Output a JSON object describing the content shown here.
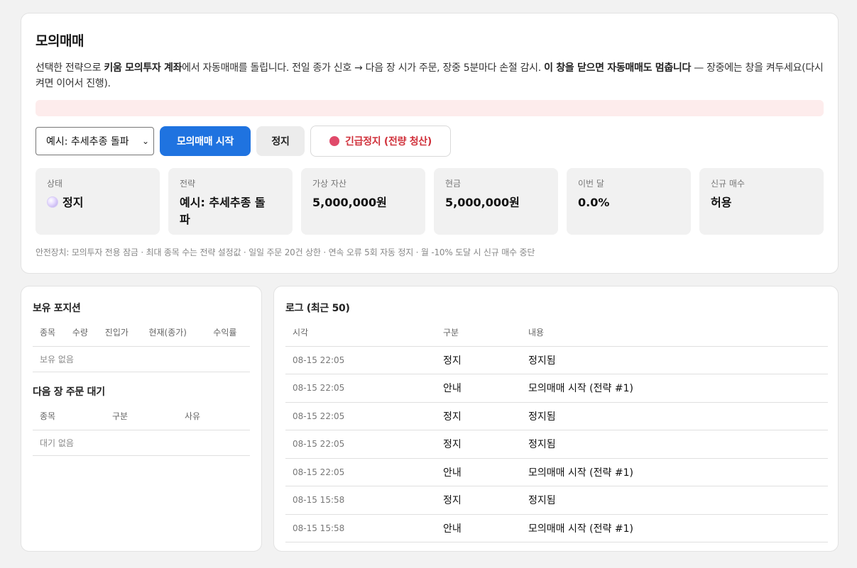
{
  "header": {
    "title": "모의매매",
    "desc_part1": "선택한 전략으로 ",
    "desc_bold1": "키움 모의투자 계좌",
    "desc_part2": "에서 자동매매를 돌립니다. 전일 종가 신호 → 다음 장 시가 주문, 장중 5분마다 손절 감시. ",
    "desc_bold2": "이 창을 닫으면 자동매매도 멈춥니다",
    "desc_part3": " — 장중에는 창을 켜두세요(다시 켜면 이어서 진행)."
  },
  "controls": {
    "strategy_selected": "예시: 추세추종 돌파",
    "start_label": "모의매매 시작",
    "stop_label": "정지",
    "emergency_label": "긴급정지 (전량 청산)"
  },
  "stats": [
    {
      "label": "상태",
      "value": "정지"
    },
    {
      "label": "전략",
      "value": "예시: 추세추종 돌파"
    },
    {
      "label": "가상 자산",
      "value": "5,000,000원"
    },
    {
      "label": "현금",
      "value": "5,000,000원"
    },
    {
      "label": "이번 달",
      "value": "0.0%"
    },
    {
      "label": "신규 매수",
      "value": "허용"
    }
  ],
  "safety_text": "안전장치: 모의투자 전용 잠금 · 최대 종목 수는 전략 설정값 · 일일 주문 20건 상한 · 연속 오류 5회 자동 정지 · 월 -10% 도달 시 신규 매수 중단",
  "positions": {
    "title": "보유 포지션",
    "columns": [
      "종목",
      "수량",
      "진입가",
      "현재(종가)",
      "수익률"
    ],
    "empty": "보유 없음"
  },
  "pending": {
    "title": "다음 장 주문 대기",
    "columns": [
      "종목",
      "구분",
      "사유"
    ],
    "empty": "대기 없음"
  },
  "log": {
    "title": "로그 (최근 50)",
    "columns": [
      "시각",
      "구분",
      "내용"
    ],
    "rows": [
      {
        "time": "08-15 22:05",
        "kind": "정지",
        "msg": "정지됨"
      },
      {
        "time": "08-15 22:05",
        "kind": "안내",
        "msg": "모의매매 시작 (전략 #1)"
      },
      {
        "time": "08-15 22:05",
        "kind": "정지",
        "msg": "정지됨"
      },
      {
        "time": "08-15 22:05",
        "kind": "정지",
        "msg": "정지됨"
      },
      {
        "time": "08-15 22:05",
        "kind": "안내",
        "msg": "모의매매 시작 (전략 #1)"
      },
      {
        "time": "08-15 15:58",
        "kind": "정지",
        "msg": "정지됨"
      },
      {
        "time": "08-15 15:58",
        "kind": "안내",
        "msg": "모의매매 시작 (전략 #1)"
      }
    ]
  },
  "colors": {
    "primary": "#1f73e0",
    "danger": "#d0303a",
    "alert_bg": "#fdecec"
  }
}
